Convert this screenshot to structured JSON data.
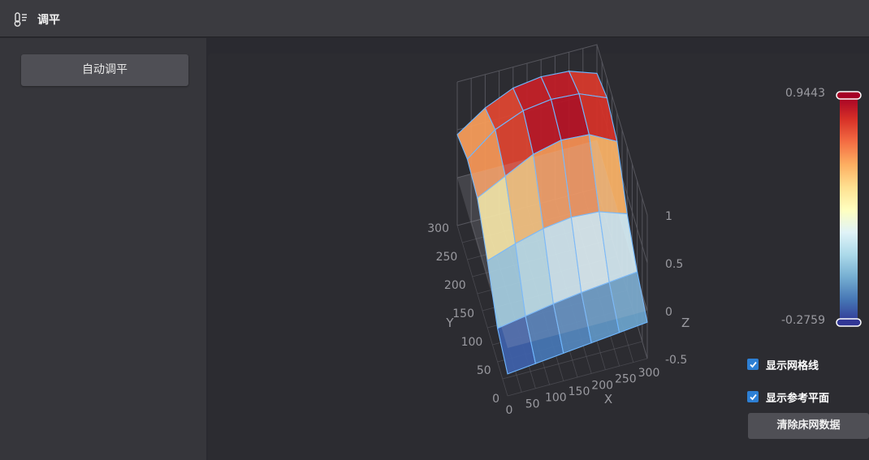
{
  "window": {
    "title": "调平",
    "icon": "thermometer-menu-icon"
  },
  "sidebar": {
    "auto_level_label": "自动调平"
  },
  "chart_data": {
    "type": "surface3d",
    "x_label": "X",
    "y_label": "Y",
    "z_label": "Z",
    "x_ticks": [
      "0",
      "50",
      "100",
      "150",
      "200",
      "250",
      "300"
    ],
    "y_ticks": [
      "0",
      "50",
      "100",
      "150",
      "200",
      "250",
      "300"
    ],
    "z_ticks": [
      "-0.5",
      "0",
      "0.5",
      "1"
    ],
    "xlim": [
      0,
      300
    ],
    "ylim": [
      0,
      300
    ],
    "zlim": [
      -0.5,
      1
    ],
    "x": [
      0,
      60,
      120,
      180,
      240,
      300
    ],
    "y": [
      0,
      60,
      120,
      180,
      240,
      300
    ],
    "z": [
      [
        -0.27,
        -0.24,
        -0.21,
        -0.18,
        -0.15,
        -0.12
      ],
      [
        -0.15,
        -0.1,
        -0.05,
        -0.01,
        0.02,
        0.05
      ],
      [
        0.2,
        0.3,
        0.38,
        0.42,
        0.4,
        0.3
      ],
      [
        0.5,
        0.65,
        0.8,
        0.87,
        0.85,
        0.7
      ],
      [
        0.55,
        0.78,
        0.9,
        0.94,
        0.92,
        0.8
      ],
      [
        0.45,
        0.65,
        0.78,
        0.82,
        0.8,
        0.7
      ]
    ],
    "reference_plane_z": 0,
    "colorbar": {
      "max": "0.9443",
      "min": "-0.2759",
      "colors": [
        "#313695",
        "#4575b4",
        "#74add1",
        "#abd9e9",
        "#e0f3f8",
        "#ffffbf",
        "#fee090",
        "#fdae61",
        "#f46d43",
        "#d73027",
        "#a50026"
      ]
    }
  },
  "options": {
    "show_grid_label": "显示网格线",
    "show_grid_checked": true,
    "show_ref_plane_label": "显示参考平面",
    "show_ref_plane_checked": true
  },
  "actions": {
    "clear_mesh_label": "清除床网数据"
  }
}
